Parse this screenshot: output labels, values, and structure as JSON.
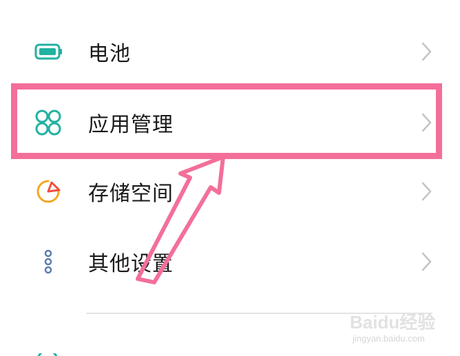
{
  "settings_list": {
    "items": [
      {
        "label": "电池",
        "icon": "battery-icon",
        "icon_color": "#20b2a0"
      },
      {
        "label": "应用管理",
        "icon": "app-grid-icon",
        "icon_color": "#20b2a0"
      },
      {
        "label": "存储空间",
        "icon": "storage-pie-icon",
        "icon_color": "#f5a623"
      },
      {
        "label": "其他设置",
        "icon": "more-dots-icon",
        "icon_color": "#5b7bb0"
      }
    ]
  },
  "annotation": {
    "highlight_color": "#f36f99",
    "highlighted_item": "应用管理",
    "arrow_color": "#f36f99"
  },
  "watermark": {
    "brand": "Baidu经验",
    "url": "jingyan.baidu.com"
  },
  "colors": {
    "background": "#ffffff",
    "text": "#1a1a1a",
    "chevron": "#c4c4c4",
    "divider": "#e4e4e4"
  }
}
